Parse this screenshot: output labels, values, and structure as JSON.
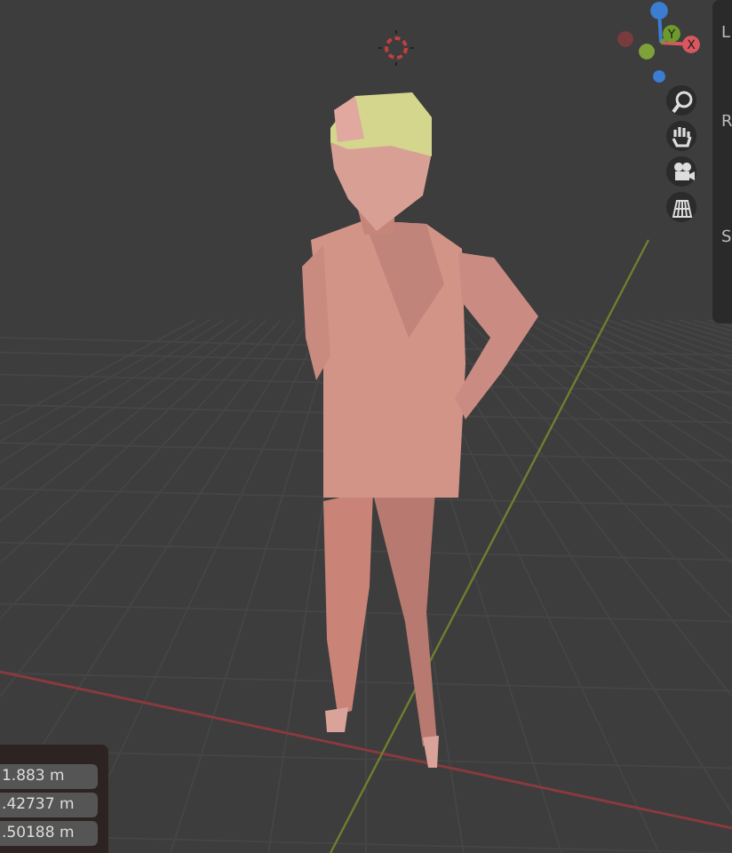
{
  "gizmo": {
    "axes": [
      {
        "label": "Y",
        "kind": "y"
      },
      {
        "label": "X",
        "kind": "x"
      }
    ]
  },
  "nav_buttons": [
    {
      "kind": "zoom"
    },
    {
      "kind": "pan"
    },
    {
      "kind": "camera"
    },
    {
      "kind": "grid"
    }
  ],
  "sidebar": {
    "labels": [
      "L",
      "R",
      "S"
    ]
  },
  "dimensions_panel": {
    "values": [
      "1.883 m",
      ".42737 m",
      ".50188 m"
    ]
  }
}
